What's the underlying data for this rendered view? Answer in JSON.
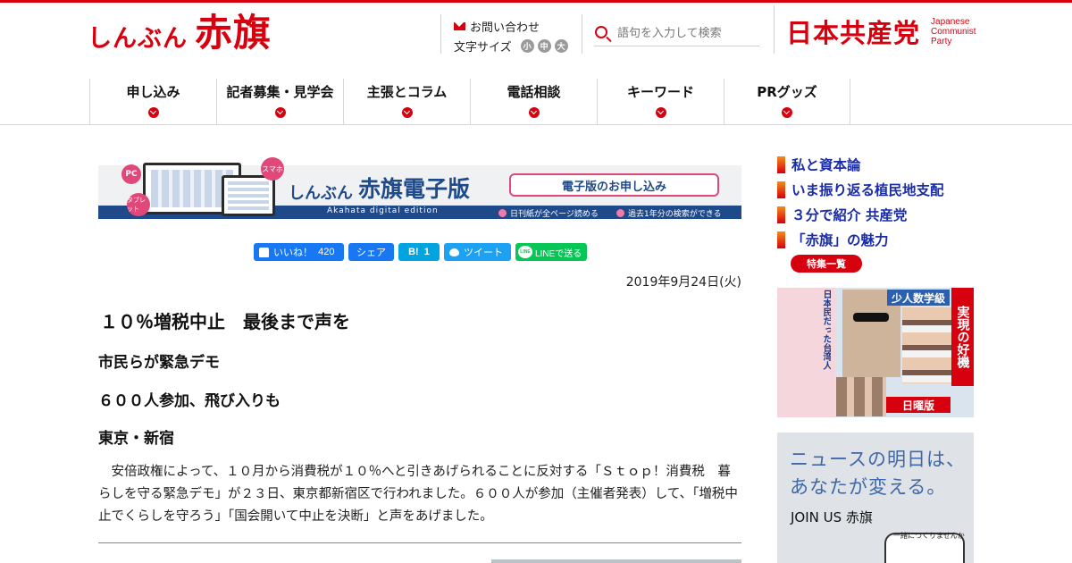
{
  "header": {
    "logo_small": "しんぶん",
    "logo_big": "赤旗",
    "contact_label": "お問い合わせ",
    "font_size_label": "文字サイズ",
    "font_sizes": [
      "小",
      "中",
      "大"
    ],
    "search_placeholder": "語句を入力して検索",
    "party_name_jp": "日本共産党",
    "party_name_en": [
      "Japanese",
      "Communist",
      "Party"
    ]
  },
  "nav": {
    "items": [
      "申し込み",
      "記者募集・見学会",
      "主張とコラム",
      "電話相談",
      "キーワード",
      "PRグッズ"
    ]
  },
  "banner": {
    "badge_pc": "PC",
    "badge_tablet": "タブレット",
    "badge_phone": "スマホ",
    "title_small": "しんぶん",
    "title_big": "赤旗電子版",
    "subtitle": "Akahata digital edition",
    "button": "電子版のお申し込み",
    "feature_1": "日刊紙が全ページ読める",
    "feature_2": "過去1年分の検索ができる"
  },
  "share": {
    "like_label": "いいね！",
    "like_count": "420",
    "share_label": "シェア",
    "hatena_label": "B!",
    "hatena_count": "1",
    "tweet_label": "ツイート",
    "line_icon": "LINE",
    "line_label": "LINEで送る"
  },
  "article": {
    "date": "2019年9月24日(火)",
    "title": "１０％増税中止　最後まで声を",
    "subtitles": [
      "市民らが緊急デモ",
      "６００人参加、飛び入りも",
      "東京・新宿"
    ],
    "body": "安倍政権によって、１０月から消費税が１０％へと引きあげられることに反対する「Ｓｔｏｐ！消費税　暮らしを守る緊急デモ」が２３日、東京都新宿区で行われました。６００人が参加（主催者発表）して、「増税中止でくらしを守ろう」「国会開いて中止を決断」と声をあげました。"
  },
  "sidebar": {
    "links": [
      "私と資本論",
      "いま振り返る植民地支配",
      "３分で紹介 共産党",
      "「赤旗」の魅力"
    ],
    "feature_list_button": "特集一覧",
    "promo_headline": "少人数学級",
    "promo_side": "実現の好機",
    "promo_sunday": "日曜版",
    "promo_vertical": "日本民だった台湾人",
    "promo2_line1": "ニュースの明日は、",
    "promo2_line2": "あなたが変える。",
    "promo2_join": "JOIN US 赤旗",
    "promo2_small": "一緒につくりませんか"
  }
}
